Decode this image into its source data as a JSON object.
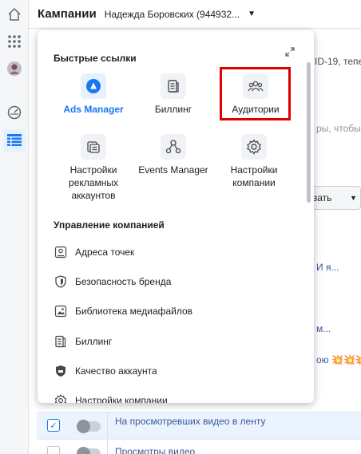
{
  "header": {
    "title": "Кампании",
    "account_name": "Надежда Боровских (944932..."
  },
  "rail": {
    "icons": [
      "home-icon",
      "apps-grid-icon",
      "profile-avatar",
      "dashboard-gauge-icon",
      "table-icon"
    ]
  },
  "background": {
    "notice_fragment": "ID-19, тепе",
    "search_fragment": "ры, чтобы",
    "button_fragment": "вать",
    "link_fragment_1": "И я...",
    "link_fragment_2": "м...",
    "link_fragment_3": "ою 💥💥💥",
    "rows": [
      {
        "name": "На просмотревших видео в ленту",
        "checked": true
      },
      {
        "name": "Просмотры видео",
        "checked": false
      }
    ]
  },
  "popover": {
    "quick_links_title": "Быстрые ссылки",
    "quick_links": [
      {
        "label": "Ads Manager",
        "icon": "ads-manager-icon",
        "primary": true
      },
      {
        "label": "Биллинг",
        "icon": "billing-icon",
        "primary": false
      },
      {
        "label": "Аудитории",
        "icon": "audiences-icon",
        "primary": false,
        "highlighted": true
      },
      {
        "label": "Настройки рекламных аккаунтов",
        "icon": "ad-account-settings-icon",
        "primary": false
      },
      {
        "label": "Events Manager",
        "icon": "events-manager-icon",
        "primary": false
      },
      {
        "label": "Настройки компании",
        "icon": "business-settings-icon",
        "primary": false
      }
    ],
    "management_title": "Управление компанией",
    "management_items": [
      {
        "label": "Адреса точек",
        "icon": "location-pin-icon"
      },
      {
        "label": "Безопасность бренда",
        "icon": "shield-icon"
      },
      {
        "label": "Библиотека медиафайлов",
        "icon": "media-library-icon"
      },
      {
        "label": "Биллинг",
        "icon": "billing-icon"
      },
      {
        "label": "Качество аккаунта",
        "icon": "account-quality-icon"
      },
      {
        "label": "Настройки компании",
        "icon": "gear-icon"
      }
    ]
  },
  "colors": {
    "accent": "#1877f2",
    "highlight_box": "#e00000",
    "link": "#385898"
  }
}
